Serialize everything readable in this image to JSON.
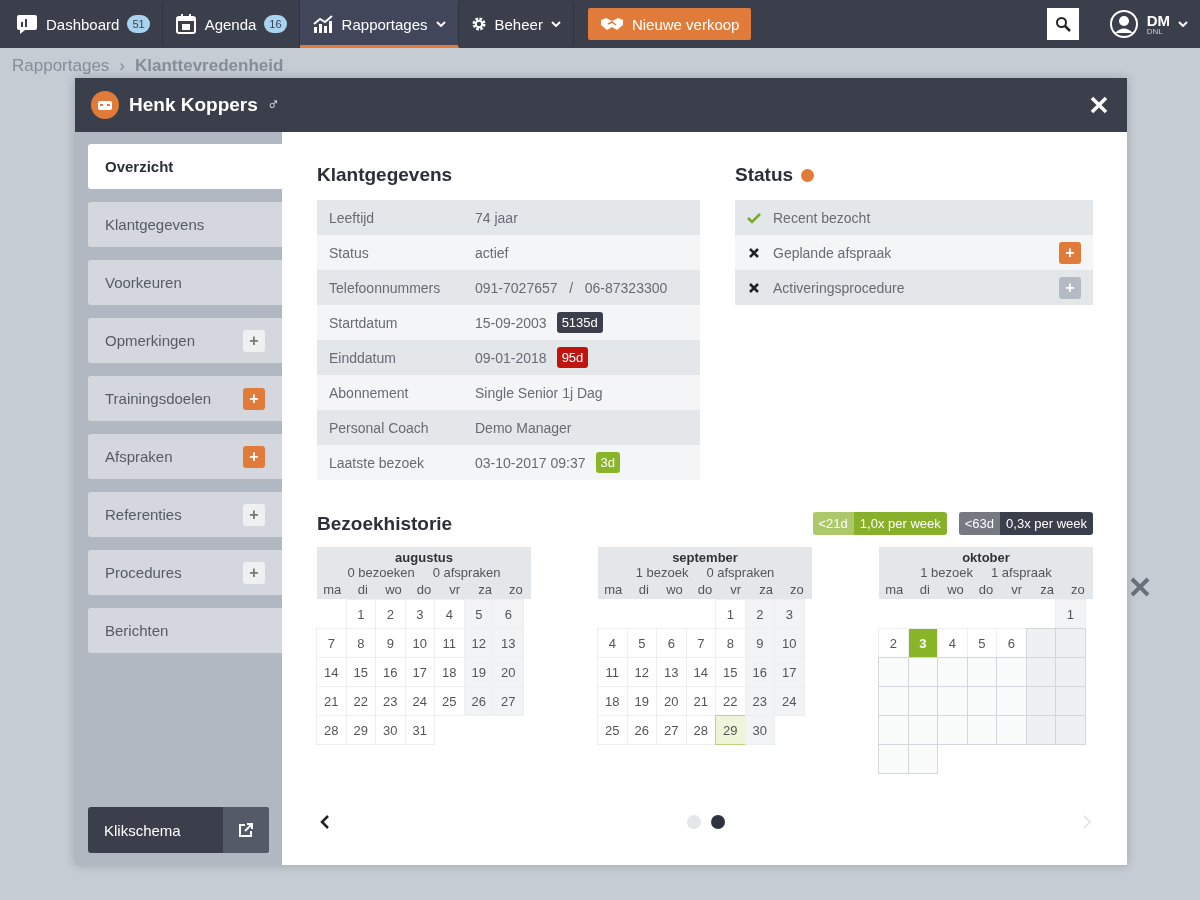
{
  "nav": {
    "items": [
      {
        "label": "Dashboard",
        "badge": "51",
        "selected": false,
        "caret": false
      },
      {
        "label": "Agenda",
        "badge": "16",
        "selected": false,
        "caret": false
      },
      {
        "label": "Rapportages",
        "selected": true,
        "caret": true
      },
      {
        "label": "Beheer",
        "selected": false,
        "caret": true
      }
    ],
    "action": "Nieuwe verkoop",
    "user": {
      "initials": "DM",
      "sub": "DNL"
    }
  },
  "breadcrumb": {
    "parent": "Rapportages",
    "separator": "›",
    "current": "Klanttevredenheid"
  },
  "modal": {
    "title": "Henk Koppers",
    "gender": "♂",
    "sidebar": [
      {
        "label": "Overzicht",
        "selected": true
      },
      {
        "label": "Klantgegevens",
        "selected": false
      },
      {
        "label": "Voorkeuren",
        "selected": false
      },
      {
        "label": "Opmerkingen",
        "selected": false,
        "add": {
          "label": "+",
          "kind": "plain"
        }
      },
      {
        "label": "Trainingsdoelen",
        "selected": false,
        "add": {
          "label": "+",
          "kind": "accent"
        }
      },
      {
        "label": "Afspraken",
        "selected": false,
        "add": {
          "label": "+",
          "kind": "accent"
        }
      },
      {
        "label": "Referenties",
        "selected": false,
        "add": {
          "label": "+",
          "kind": "plain"
        }
      },
      {
        "label": "Procedures",
        "selected": false,
        "add": {
          "label": "+",
          "kind": "plain"
        }
      },
      {
        "label": "Berichten",
        "selected": false
      }
    ],
    "footer_button": "Klikschema",
    "details": {
      "title": "Klantgegevens",
      "rows": [
        {
          "label": "Leeftijd",
          "value": "74 jaar"
        },
        {
          "label": "Status",
          "value": "actief"
        },
        {
          "label": "Telefoonnummers",
          "value": "091-7027657   /   06-87323300"
        },
        {
          "label": "Startdatum",
          "value": "15-09-2003",
          "tag": {
            "text": "5135d",
            "color": "#3b3f4c"
          }
        },
        {
          "label": "Einddatum",
          "value": "09-01-2018",
          "tag": {
            "text": "95d",
            "color": "#c0150f"
          }
        },
        {
          "label": "Abonnement",
          "value": "Single Senior 1j Dag"
        },
        {
          "label": "Personal Coach",
          "value": "Demo Manager"
        },
        {
          "label": "Laatste bezoek",
          "value": "03-10-2017 09:37",
          "tag": {
            "text": "3d",
            "color": "#8ab52a"
          }
        }
      ]
    },
    "status": {
      "title": "Status",
      "color": "#e07b39",
      "items": [
        {
          "label": "Recent bezocht",
          "checked": true
        },
        {
          "label": "Geplande afspraak",
          "checked": false,
          "add": {
            "label": "+",
            "kind": "accent"
          }
        },
        {
          "label": "Activeringsprocedure",
          "checked": false,
          "add": {
            "label": "+",
            "kind": "muted"
          }
        }
      ]
    },
    "history": {
      "title": "Bezoekhistorie",
      "legend": [
        {
          "range": "<21d",
          "rate": "1,0x per week",
          "color": "#88b02a"
        },
        {
          "range": "<63d",
          "rate": "0,3x per week",
          "color": "#3b3f4c"
        }
      ],
      "months": [
        {
          "name": "augustus",
          "visits": "0 bezoeken",
          "appointments": "0 afspraken",
          "weekdays": [
            "ma",
            "di",
            "wo",
            "do",
            "vr",
            "za",
            "zo"
          ],
          "weeks": [
            [
              {
                "kind": "gap"
              },
              {
                "kind": "day",
                "day": "1"
              },
              {
                "kind": "day",
                "day": "2"
              },
              {
                "kind": "day",
                "day": "3"
              },
              {
                "kind": "day",
                "day": "4"
              },
              {
                "kind": "day",
                "day": "5"
              },
              {
                "kind": "day",
                "day": "6"
              }
            ],
            [
              {
                "kind": "day",
                "day": "7"
              },
              {
                "kind": "day",
                "day": "8"
              },
              {
                "kind": "day",
                "day": "9"
              },
              {
                "kind": "day",
                "day": "10"
              },
              {
                "kind": "day",
                "day": "11"
              },
              {
                "kind": "day",
                "day": "12"
              },
              {
                "kind": "day",
                "day": "13"
              }
            ],
            [
              {
                "kind": "day",
                "day": "14"
              },
              {
                "kind": "day",
                "day": "15"
              },
              {
                "kind": "day",
                "day": "16"
              },
              {
                "kind": "day",
                "day": "17"
              },
              {
                "kind": "day",
                "day": "18"
              },
              {
                "kind": "day",
                "day": "19"
              },
              {
                "kind": "day",
                "day": "20"
              }
            ],
            [
              {
                "kind": "day",
                "day": "21"
              },
              {
                "kind": "day",
                "day": "22"
              },
              {
                "kind": "day",
                "day": "23"
              },
              {
                "kind": "day",
                "day": "24"
              },
              {
                "kind": "day",
                "day": "25"
              },
              {
                "kind": "day",
                "day": "26"
              },
              {
                "kind": "day",
                "day": "27"
              }
            ],
            [
              {
                "kind": "day",
                "day": "28"
              },
              {
                "kind": "day",
                "day": "29"
              },
              {
                "kind": "day",
                "day": "30"
              },
              {
                "kind": "day",
                "day": "31"
              }
            ]
          ]
        },
        {
          "name": "september",
          "visits": "1 bezoek",
          "appointments": "0 afspraken",
          "weekdays": [
            "ma",
            "di",
            "wo",
            "do",
            "vr",
            "za",
            "zo"
          ],
          "weeks": [
            [
              {
                "kind": "gap"
              },
              {
                "kind": "gap"
              },
              {
                "kind": "gap"
              },
              {
                "kind": "gap"
              },
              {
                "kind": "day",
                "day": "1"
              },
              {
                "kind": "day",
                "day": "2"
              },
              {
                "kind": "day",
                "day": "3"
              }
            ],
            [
              {
                "kind": "day",
                "day": "4"
              },
              {
                "kind": "day",
                "day": "5"
              },
              {
                "kind": "day",
                "day": "6"
              },
              {
                "kind": "day",
                "day": "7"
              },
              {
                "kind": "day",
                "day": "8"
              },
              {
                "kind": "day",
                "day": "9"
              },
              {
                "kind": "day",
                "day": "10"
              }
            ],
            [
              {
                "kind": "day",
                "day": "11"
              },
              {
                "kind": "day",
                "day": "12"
              },
              {
                "kind": "day",
                "day": "13"
              },
              {
                "kind": "day",
                "day": "14"
              },
              {
                "kind": "day",
                "day": "15"
              },
              {
                "kind": "day",
                "day": "16"
              },
              {
                "kind": "day",
                "day": "17"
              }
            ],
            [
              {
                "kind": "day",
                "day": "18"
              },
              {
                "kind": "day",
                "day": "19"
              },
              {
                "kind": "day",
                "day": "20"
              },
              {
                "kind": "day",
                "day": "21"
              },
              {
                "kind": "day",
                "day": "22"
              },
              {
                "kind": "day",
                "day": "23"
              },
              {
                "kind": "day",
                "day": "24"
              }
            ],
            [
              {
                "kind": "day",
                "day": "25"
              },
              {
                "kind": "day",
                "day": "26"
              },
              {
                "kind": "day",
                "day": "27"
              },
              {
                "kind": "day",
                "day": "28"
              },
              {
                "kind": "appointment",
                "day": "29"
              },
              {
                "kind": "day",
                "day": "30"
              }
            ]
          ]
        },
        {
          "name": "oktober",
          "visits": "1 bezoek",
          "appointments": "1 afspraak",
          "weekdays": [
            "ma",
            "di",
            "wo",
            "do",
            "vr",
            "za",
            "zo"
          ],
          "weeks": [
            [
              {
                "kind": "gap"
              },
              {
                "kind": "gap"
              },
              {
                "kind": "gap"
              },
              {
                "kind": "gap"
              },
              {
                "kind": "gap"
              },
              {
                "kind": "gap"
              },
              {
                "kind": "day",
                "day": "1"
              }
            ],
            [
              {
                "kind": "day",
                "day": "2"
              },
              {
                "kind": "visit",
                "day": "3"
              },
              {
                "kind": "day",
                "day": "4"
              },
              {
                "kind": "day",
                "day": "5"
              },
              {
                "kind": "day",
                "day": "6"
              },
              {
                "kind": "blank"
              },
              {
                "kind": "blank"
              }
            ],
            [
              {
                "kind": "blank"
              },
              {
                "kind": "blank"
              },
              {
                "kind": "blank"
              },
              {
                "kind": "blank"
              },
              {
                "kind": "blank"
              },
              {
                "kind": "blank"
              },
              {
                "kind": "blank"
              }
            ],
            [
              {
                "kind": "blank"
              },
              {
                "kind": "blank"
              },
              {
                "kind": "blank"
              },
              {
                "kind": "blank"
              },
              {
                "kind": "blank"
              },
              {
                "kind": "blank"
              },
              {
                "kind": "blank"
              }
            ],
            [
              {
                "kind": "blank"
              },
              {
                "kind": "blank"
              },
              {
                "kind": "blank"
              },
              {
                "kind": "blank"
              },
              {
                "kind": "blank"
              },
              {
                "kind": "blank"
              },
              {
                "kind": "blank"
              }
            ],
            [
              {
                "kind": "blank"
              },
              {
                "kind": "blank"
              }
            ]
          ]
        }
      ],
      "pages": [
        {
          "selected": false
        },
        {
          "selected": true
        }
      ]
    }
  }
}
